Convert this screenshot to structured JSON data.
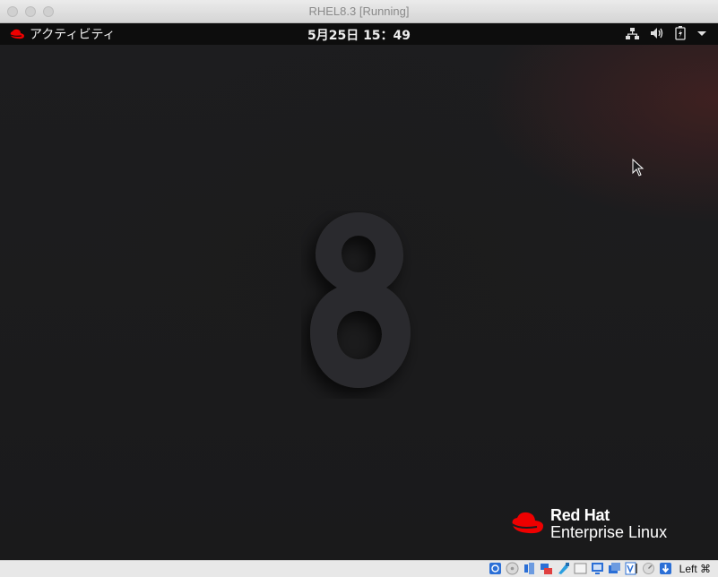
{
  "window": {
    "title": "RHEL8.3 [Running]"
  },
  "gnome_topbar": {
    "activities_label": "アクティビティ",
    "clock": "5月25日  15：49",
    "tray_icons": [
      "network-wired-icon",
      "volume-icon",
      "battery-charging-icon",
      "system-menu-arrow-icon"
    ]
  },
  "desktop": {
    "wallpaper_glyph": "8",
    "logo_brand": "Red Hat",
    "logo_product": "Enterprise Linux"
  },
  "statusbar": {
    "icons": [
      "hard-disk-icon",
      "optical-drive-icon",
      "audio-icon",
      "network-icon",
      "usb-icon",
      "shared-folders-icon",
      "display-icon",
      "video-capture-icon",
      "recording-icon",
      "cpu-icon",
      "mouse-integration-icon",
      "keyboard-icon"
    ],
    "host_key": "Left ⌘"
  },
  "colors": {
    "redhat_red": "#ee0000",
    "topbar": "#0d0d0d",
    "desktop": "#1c1c1e"
  }
}
